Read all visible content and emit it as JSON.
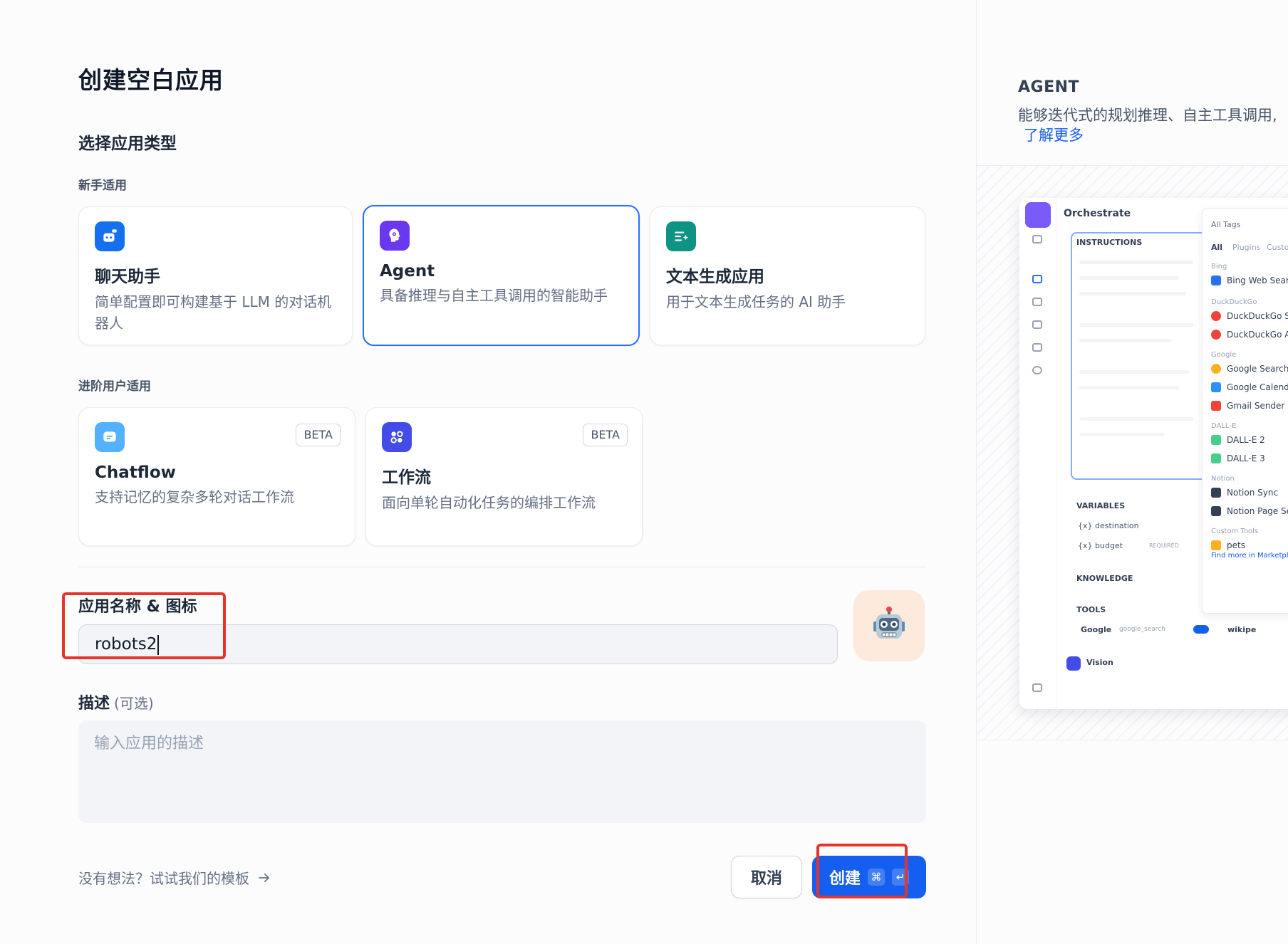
{
  "page": {
    "title": "创建空白应用",
    "section_title": "选择应用类型",
    "group_beginner": "新手适用",
    "group_advanced": "进阶用户适用"
  },
  "cards": [
    {
      "name": "聊天助手",
      "desc": "简单配置即可构建基于 LLM 的对话机器人",
      "icon": "chat-bot-icon",
      "color": "#1570ef"
    },
    {
      "name": "Agent",
      "desc": "具备推理与自主工具调用的智能助手",
      "icon": "agent-brain-icon",
      "color": "#6938ef",
      "selected": true
    },
    {
      "name": "文本生成应用",
      "desc": "用于文本生成任务的 AI 助手",
      "icon": "text-generate-icon",
      "color": "#0e9384"
    },
    {
      "name": "Chatflow",
      "desc": "支持记忆的复杂多轮对话工作流",
      "icon": "chatflow-icon",
      "color": "#53b1fd",
      "badge": "BETA"
    },
    {
      "name": "工作流",
      "desc": "面向单轮自动化任务的编排工作流",
      "icon": "workflow-icon",
      "color": "#444ce7",
      "badge": "BETA"
    }
  ],
  "form": {
    "name_label": "应用名称 & 图标",
    "name_value": "robots2",
    "app_icon": "robot-emoji-icon",
    "desc_label": "描述",
    "desc_optional": "(可选)",
    "desc_placeholder": "输入应用的描述"
  },
  "footer": {
    "template_link": "没有想法？试试我们的模板",
    "cancel": "取消",
    "create": "创建",
    "kbd_cmd": "⌘",
    "kbd_enter": "↵"
  },
  "preview": {
    "title": "AGENT",
    "desc": "能够迭代式的规划推理、自主工具调用,",
    "learn_more": "了解更多",
    "orchestrate": "Orchestrate",
    "instructions": "INSTRUCTIONS",
    "variables": "VARIABLES",
    "var1": "{x} destination",
    "var2": "{x} budget",
    "required": "REQUIRED",
    "knowledge": "KNOWLEDGE",
    "tools": "TOOLS",
    "tool_google": "Google",
    "tool_google_sub": "google_search",
    "tool_wiki": "wikipe",
    "vision": "Vision",
    "tags": "All Tags",
    "tab_all": "All",
    "tab_plugins": "Plugins",
    "tab_custom": "Custo",
    "cat_bing": "Bing",
    "bing_web": "Bing Web Searc",
    "cat_ddg": "DuckDuckGo",
    "ddg1": "DuckDuckGo Se",
    "ddg2": "DuckDuckGo AI",
    "cat_google": "Google",
    "g_search": "Google Search",
    "g_cal": "Google Calenda",
    "gmail": "Gmail Sender",
    "cat_dalle": "DALL-E",
    "dalle2": "DALL-E 2",
    "dalle3": "DALL-E 3",
    "cat_notion": "Notion",
    "notion_sync": "Notion Sync",
    "notion_page": "Notion Page Se",
    "cat_custom": "Custom Tools",
    "custom1": "pets",
    "find_more": "Find more in Marketpl"
  }
}
